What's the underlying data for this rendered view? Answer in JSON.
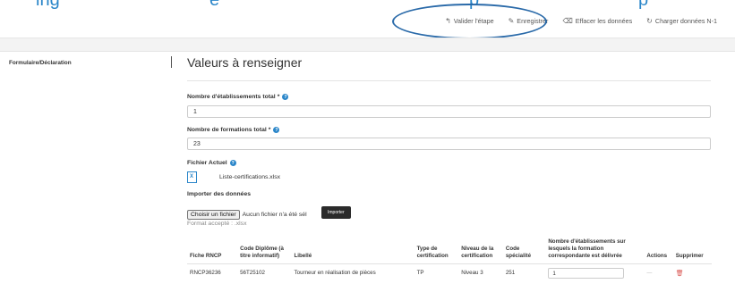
{
  "top_banner": {
    "fragments": [
      "ing",
      "e",
      "p",
      "p"
    ]
  },
  "toolbar": {
    "validate": {
      "icon": "back-arrow-icon",
      "label": "Valider l'étape"
    },
    "save": {
      "icon": "edit-icon",
      "label": "Enregistrer"
    },
    "clear": {
      "icon": "eraser-icon",
      "label": "Effacer les données"
    },
    "load": {
      "icon": "refresh-icon",
      "label": "Charger données N-1"
    }
  },
  "sidebar": {
    "items": [
      {
        "label": "Formulaire/Déclaration"
      }
    ]
  },
  "main": {
    "title": "Valeurs à renseigner",
    "fields": {
      "etablissements": {
        "label": "Nombre d'établissements total",
        "required": "*",
        "value": "1"
      },
      "formations": {
        "label": "Nombre de formations total",
        "required": "*",
        "value": "23"
      }
    },
    "current_file": {
      "label": "Fichier Actuel",
      "name": "Liste-certifications.xlsx"
    },
    "import": {
      "label": "Importer des données",
      "choose_label": "Choisir un fichier",
      "no_file": "Aucun fichier n'a été sél",
      "import_button": "Importer",
      "format_note": "Format accepté : .xlsx"
    }
  },
  "table": {
    "headers": [
      "Fiche RNCP",
      "Code Diplôme (à titre informatif)",
      "Libellé",
      "Type de certification",
      "Niveau de la certification",
      "Code spécialité",
      "Nombre d'établissements sur lesquels la formation correspondante est délivrée",
      "Actions",
      "Supprimer"
    ],
    "rows": [
      {
        "fiche": "RNCP36236",
        "code": "56T25102",
        "libelle": "Tourneur en réalisation de pièces",
        "type": "TP",
        "niveau": "Niveau 3",
        "specialite": "251",
        "nombre": "1"
      }
    ]
  },
  "colors": {
    "accent": "#2a86c9",
    "highlight": "#2a6aa9",
    "danger": "#d9534f"
  }
}
